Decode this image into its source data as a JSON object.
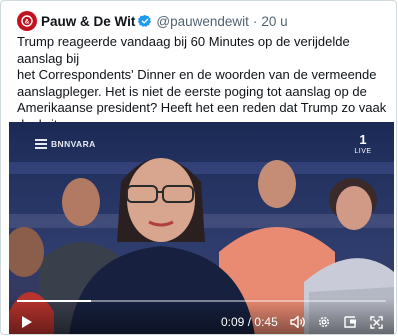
{
  "tweet": {
    "author_name": "Pauw & De Wit",
    "handle": "@pauwendewit",
    "separator": "·",
    "time": "20 u",
    "text": "Trump reageerde vandaag bij 60 Minutes op de verijdelde aanslag bij\nhet Correspondents' Dinner en de woorden van de vermeende\naanslagpleger. Het is niet de eerste poging tot aanslag op de\nAmerikaanse president? Heeft het een reden dat Trump zo vaak doelwit\nis van aanslagen?"
  },
  "media": {
    "brand": "BNNVARA",
    "channel_number": "1",
    "channel_label": "LIVE",
    "elapsed": "0:09",
    "duration": "0:45",
    "time_separator": "/",
    "progress_fraction": 0.2
  },
  "icons": {
    "avatar": "pauw-de-wit-logo-icon",
    "verified": "verified-badge-icon",
    "play": "play-icon",
    "volume": "volume-icon",
    "settings": "gear-icon",
    "pip": "picture-in-picture-icon",
    "fullscreen": "fullscreen-icon"
  },
  "colors": {
    "accent_blue": "#1d9bf0",
    "avatar_red": "#c1121f",
    "text": "#0f1419",
    "secondary": "#536471"
  }
}
